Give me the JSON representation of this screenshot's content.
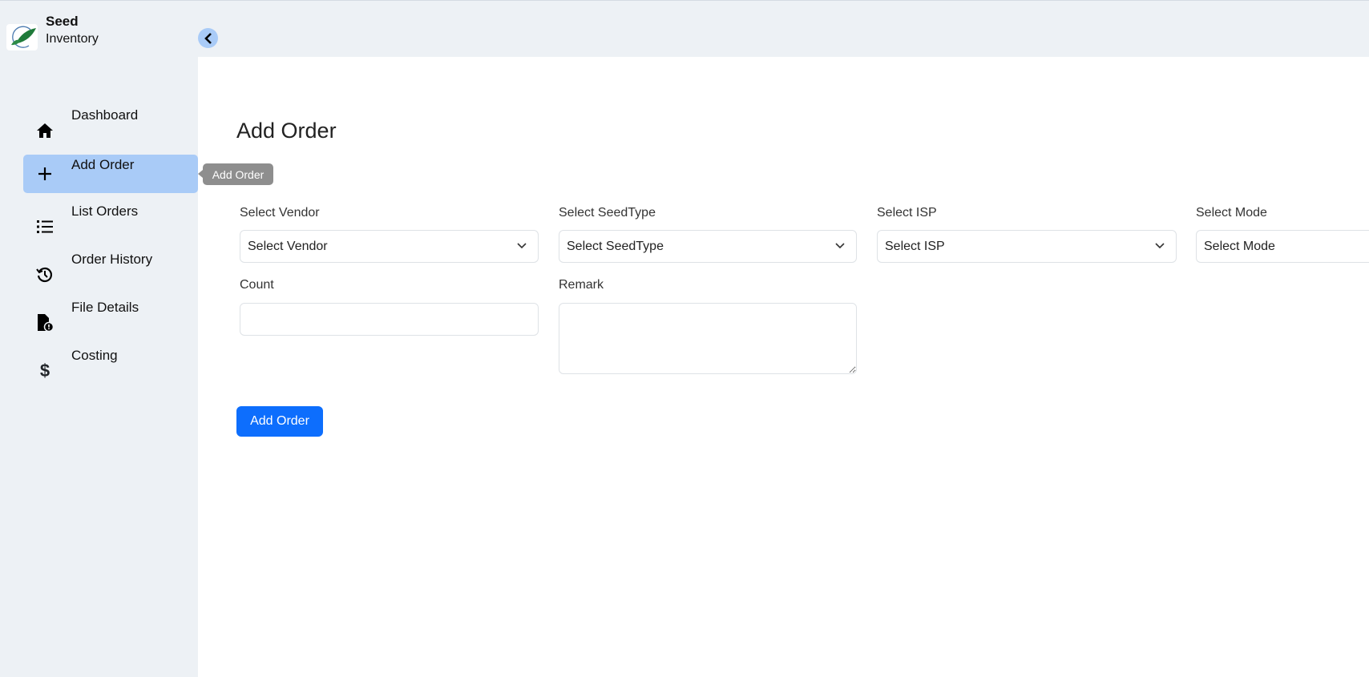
{
  "brand": {
    "line1": "Seed",
    "line2": "Inventory"
  },
  "sidebar": {
    "items": [
      {
        "label": "Dashboard",
        "icon": "home-icon"
      },
      {
        "label": "Add Order",
        "icon": "plus-icon",
        "active": true
      },
      {
        "label": "List Orders",
        "icon": "list-icon"
      },
      {
        "label": "Order History",
        "icon": "history-icon"
      },
      {
        "label": "File Details",
        "icon": "file-alert-icon"
      },
      {
        "label": "Costing",
        "icon": "dollar-icon"
      }
    ]
  },
  "tooltip": "Add Order",
  "page": {
    "title": "Add Order"
  },
  "form": {
    "vendor": {
      "label": "Select Vendor",
      "value": "Select Vendor"
    },
    "seedtype": {
      "label": "Select SeedType",
      "value": "Select SeedType"
    },
    "isp": {
      "label": "Select ISP",
      "value": "Select ISP"
    },
    "mode": {
      "label": "Select Mode",
      "value": "Select Mode"
    },
    "count": {
      "label": "Count",
      "value": ""
    },
    "remark": {
      "label": "Remark",
      "value": ""
    },
    "submit": "Add Order"
  },
  "colors": {
    "accent": "#0d6efd",
    "active_nav": "#a9cbf7",
    "sidebar_bg": "#edf1f5"
  }
}
